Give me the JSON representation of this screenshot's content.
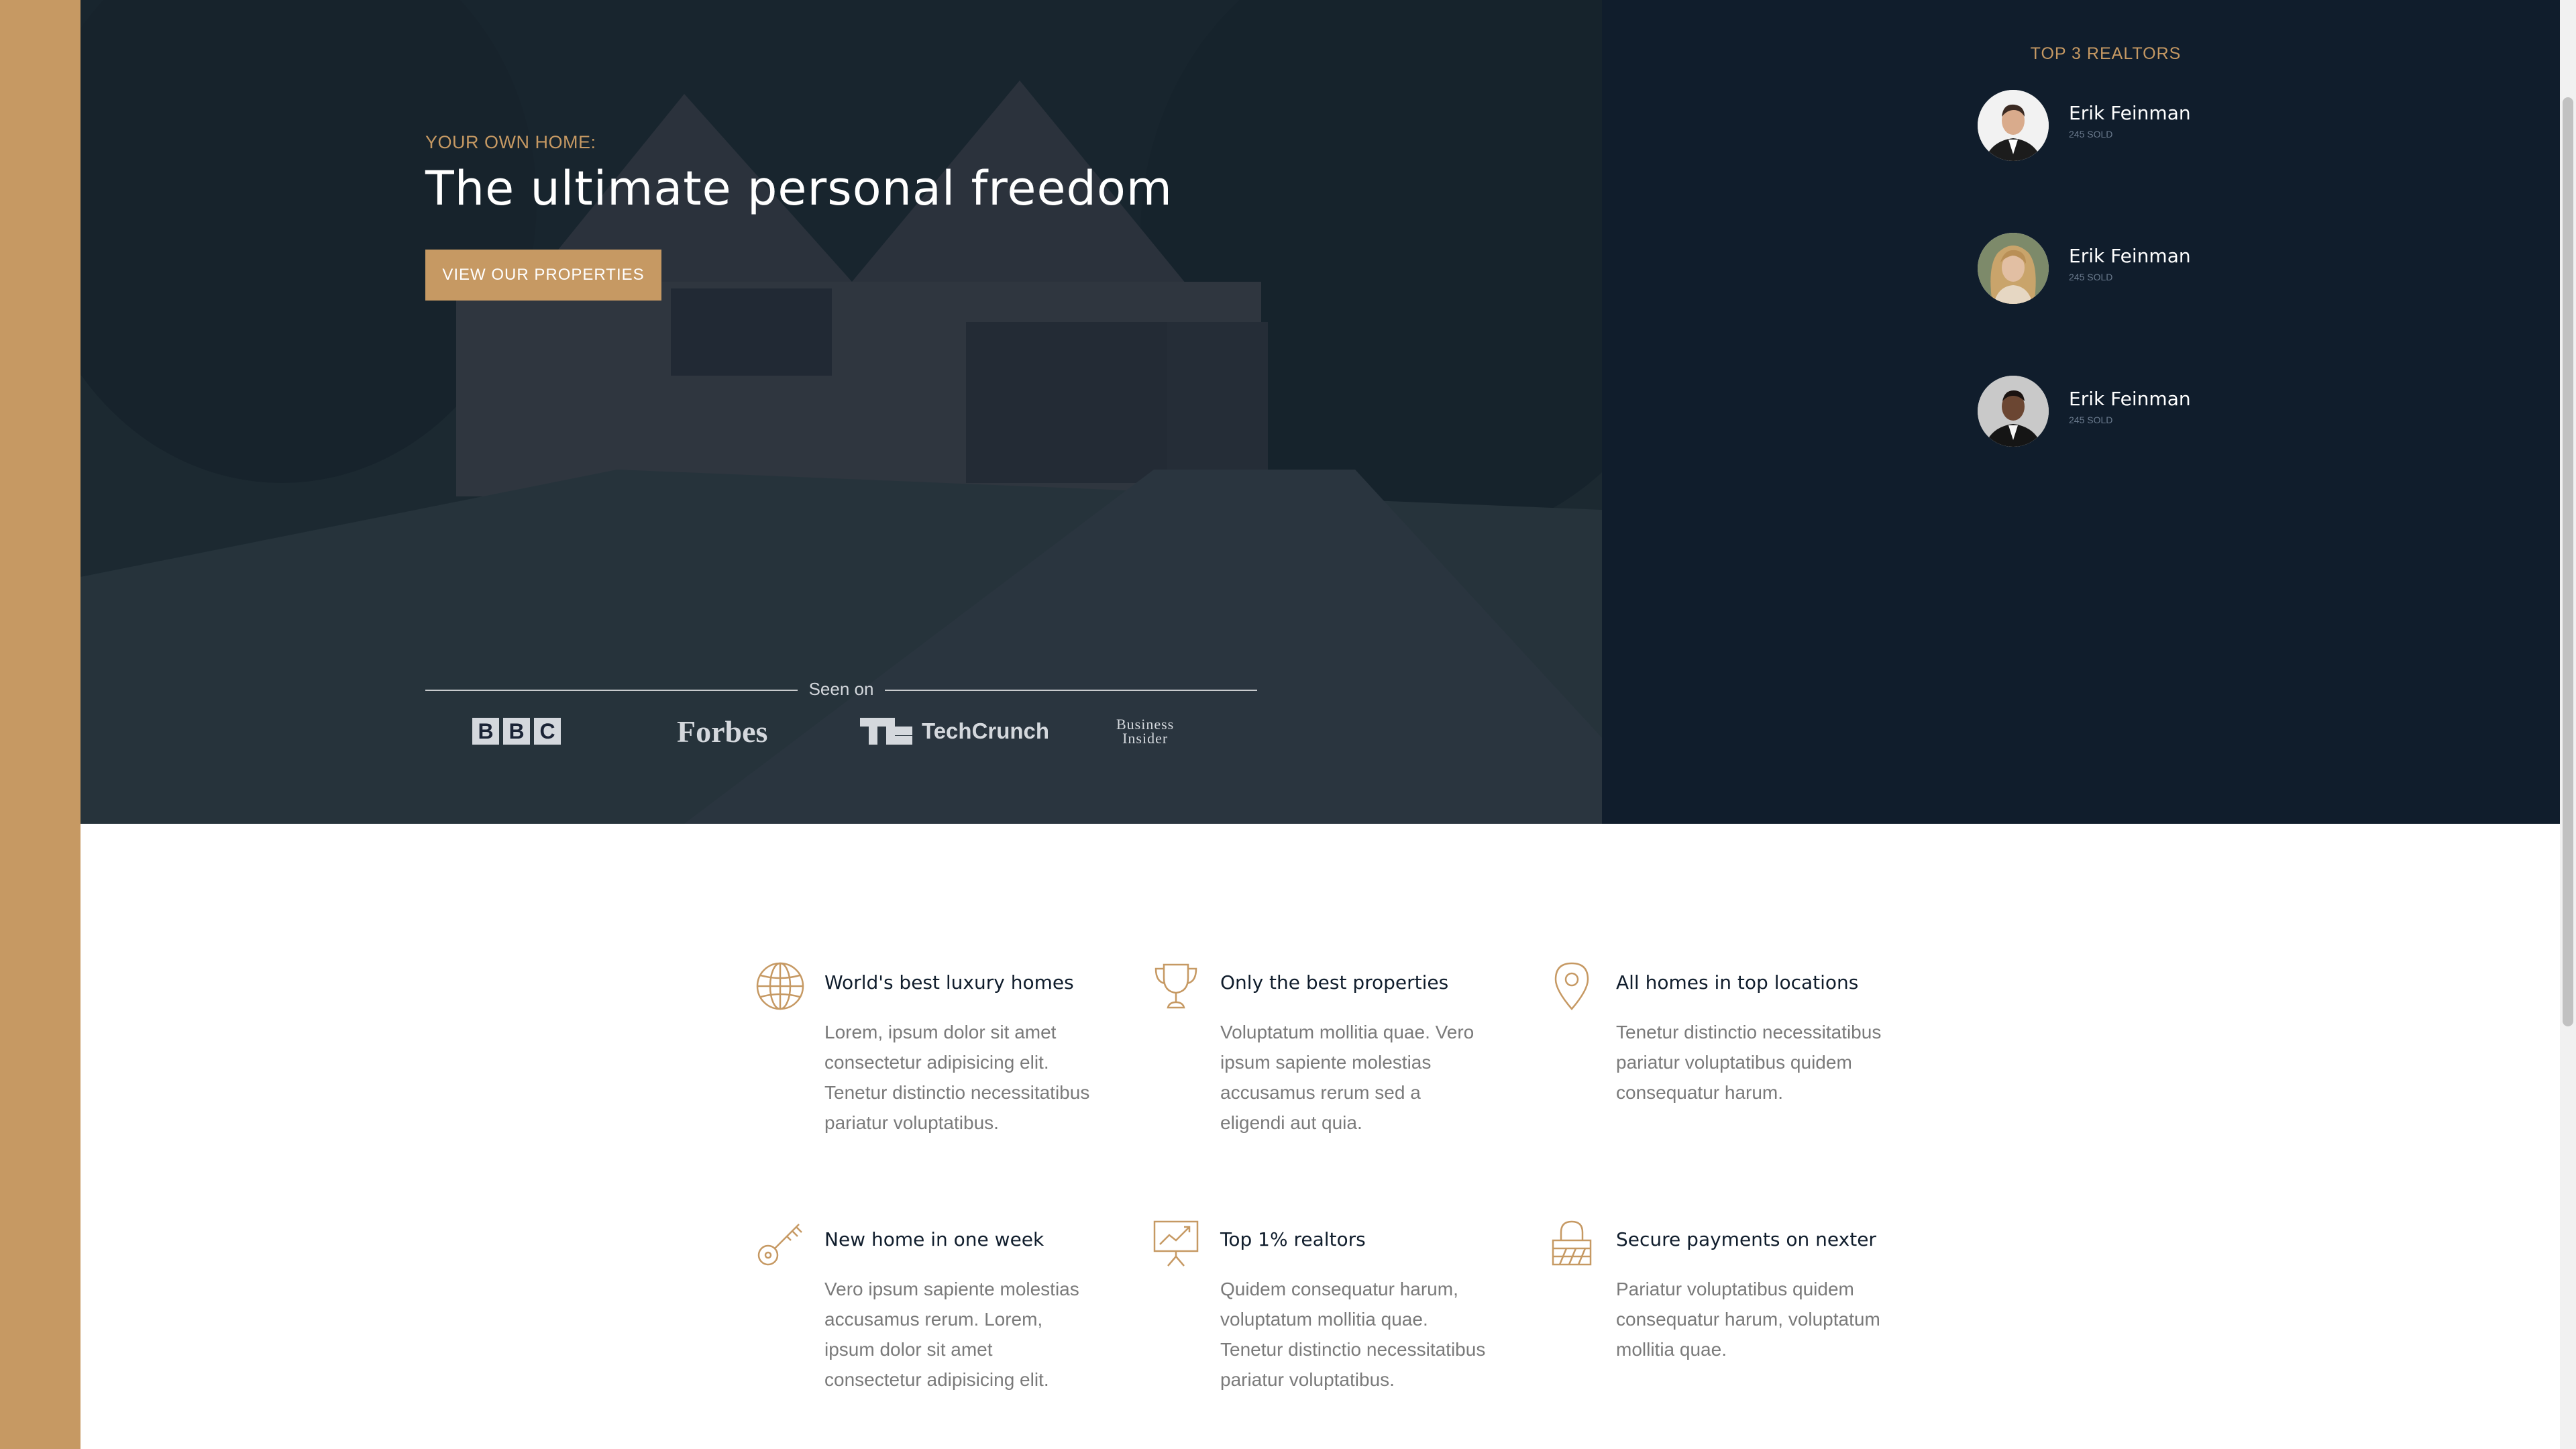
{
  "hero": {
    "subtitle": "Your own home:",
    "heading": "The ultimate personal freedom",
    "cta_label": "View our properties",
    "seen_on": "Seen on",
    "logos": {
      "bbc": [
        "B",
        "B",
        "C"
      ],
      "forbes": "Forbes",
      "techcrunch": "TechCrunch",
      "business_insider": [
        "Business",
        "Insider"
      ]
    }
  },
  "realtors": {
    "title": "Top 3 Realtors",
    "items": [
      {
        "name": "Erik Feinman",
        "sold": "245 sold"
      },
      {
        "name": "Erik Feinman",
        "sold": "245 sold"
      },
      {
        "name": "Erik Feinman",
        "sold": "245 sold"
      }
    ]
  },
  "features": [
    {
      "icon": "globe-icon",
      "title": "World's best luxury homes",
      "text": "Lorem, ipsum dolor sit amet consectetur adipisicing elit. Tenetur distinctio necessitatibus pariatur voluptatibus."
    },
    {
      "icon": "trophy-icon",
      "title": "Only the best properties",
      "text": "Voluptatum mollitia quae. Vero ipsum sapiente molestias accusamus rerum sed a eligendi aut quia."
    },
    {
      "icon": "map-pin-icon",
      "title": "All homes in top locations",
      "text": "Tenetur distinctio necessitatibus pariatur voluptatibus quidem consequatur harum."
    },
    {
      "icon": "key-icon",
      "title": "New home in one week",
      "text": "Vero ipsum sapiente molestias accusamus rerum. Lorem, ipsum dolor sit amet consectetur adipisicing elit."
    },
    {
      "icon": "presentation-chart-icon",
      "title": "Top 1% realtors",
      "text": "Quidem consequatur harum, voluptatum mollitia quae. Tenetur distinctio necessitatibus pariatur voluptatibus."
    },
    {
      "icon": "lock-icon",
      "title": "Secure payments on nexter",
      "text": "Pariatur voluptatibus quidem consequatur harum, voluptatum mollitia quae."
    }
  ],
  "colors": {
    "accent": "#c69963",
    "navy": "#101d2c",
    "text_gray": "#7a7a7a"
  }
}
